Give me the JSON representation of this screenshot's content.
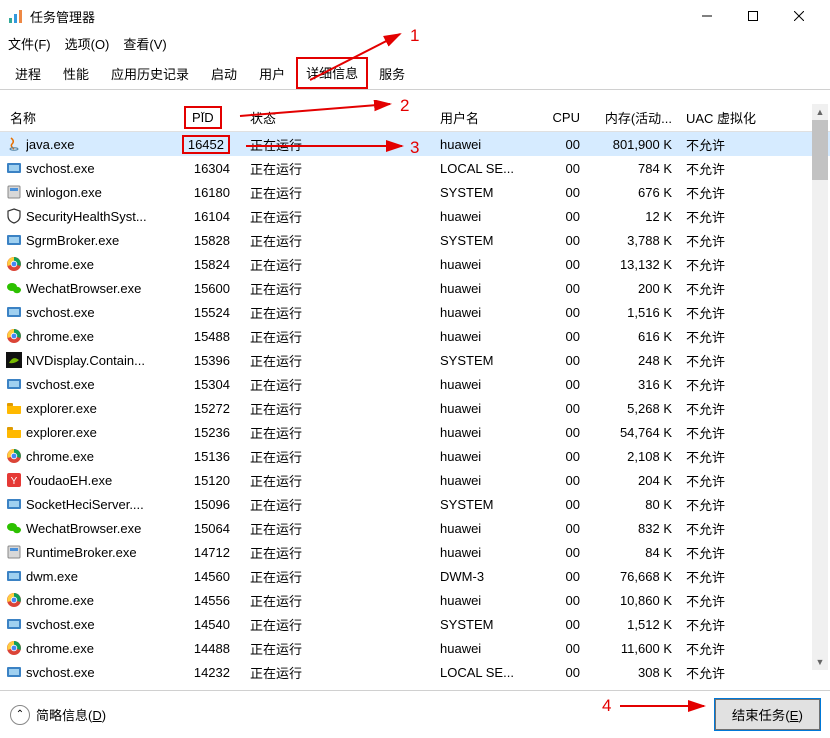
{
  "window": {
    "title": "任务管理器"
  },
  "menu": {
    "file": "文件(F)",
    "options": "选项(O)",
    "view": "查看(V)"
  },
  "tabs": {
    "processes": "进程",
    "performance": "性能",
    "app_history": "应用历史记录",
    "startup": "启动",
    "users": "用户",
    "details": "详细信息",
    "services": "服务"
  },
  "columns": {
    "name": "名称",
    "pid": "PID",
    "status": "状态",
    "user": "用户名",
    "cpu": "CPU",
    "mem": "内存(活动...",
    "uac": "UAC 虚拟化"
  },
  "rows": [
    {
      "icon": "java",
      "name": "java.exe",
      "pid": "16452",
      "status": "正在运行",
      "user": "huawei",
      "cpu": "00",
      "mem": "801,900 K",
      "uac": "不允许",
      "selected": true,
      "pid_hl": true
    },
    {
      "icon": "svc",
      "name": "svchost.exe",
      "pid": "16304",
      "status": "正在运行",
      "user": "LOCAL SE...",
      "cpu": "00",
      "mem": "784 K",
      "uac": "不允许"
    },
    {
      "icon": "exe",
      "name": "winlogon.exe",
      "pid": "16180",
      "status": "正在运行",
      "user": "SYSTEM",
      "cpu": "00",
      "mem": "676 K",
      "uac": "不允许"
    },
    {
      "icon": "shield",
      "name": "SecurityHealthSyst...",
      "pid": "16104",
      "status": "正在运行",
      "user": "huawei",
      "cpu": "00",
      "mem": "12 K",
      "uac": "不允许"
    },
    {
      "icon": "svc",
      "name": "SgrmBroker.exe",
      "pid": "15828",
      "status": "正在运行",
      "user": "SYSTEM",
      "cpu": "00",
      "mem": "3,788 K",
      "uac": "不允许"
    },
    {
      "icon": "chrome",
      "name": "chrome.exe",
      "pid": "15824",
      "status": "正在运行",
      "user": "huawei",
      "cpu": "00",
      "mem": "13,132 K",
      "uac": "不允许"
    },
    {
      "icon": "wechat",
      "name": "WechatBrowser.exe",
      "pid": "15600",
      "status": "正在运行",
      "user": "huawei",
      "cpu": "00",
      "mem": "200 K",
      "uac": "不允许"
    },
    {
      "icon": "svc",
      "name": "svchost.exe",
      "pid": "15524",
      "status": "正在运行",
      "user": "huawei",
      "cpu": "00",
      "mem": "1,516 K",
      "uac": "不允许"
    },
    {
      "icon": "chrome",
      "name": "chrome.exe",
      "pid": "15488",
      "status": "正在运行",
      "user": "huawei",
      "cpu": "00",
      "mem": "616 K",
      "uac": "不允许"
    },
    {
      "icon": "nvidia",
      "name": "NVDisplay.Contain...",
      "pid": "15396",
      "status": "正在运行",
      "user": "SYSTEM",
      "cpu": "00",
      "mem": "248 K",
      "uac": "不允许"
    },
    {
      "icon": "svc",
      "name": "svchost.exe",
      "pid": "15304",
      "status": "正在运行",
      "user": "huawei",
      "cpu": "00",
      "mem": "316 K",
      "uac": "不允许"
    },
    {
      "icon": "explorer",
      "name": "explorer.exe",
      "pid": "15272",
      "status": "正在运行",
      "user": "huawei",
      "cpu": "00",
      "mem": "5,268 K",
      "uac": "不允许"
    },
    {
      "icon": "explorer",
      "name": "explorer.exe",
      "pid": "15236",
      "status": "正在运行",
      "user": "huawei",
      "cpu": "00",
      "mem": "54,764 K",
      "uac": "不允许"
    },
    {
      "icon": "chrome",
      "name": "chrome.exe",
      "pid": "15136",
      "status": "正在运行",
      "user": "huawei",
      "cpu": "00",
      "mem": "2,108 K",
      "uac": "不允许"
    },
    {
      "icon": "youdao",
      "name": "YoudaoEH.exe",
      "pid": "15120",
      "status": "正在运行",
      "user": "huawei",
      "cpu": "00",
      "mem": "204 K",
      "uac": "不允许"
    },
    {
      "icon": "svc",
      "name": "SocketHeciServer....",
      "pid": "15096",
      "status": "正在运行",
      "user": "SYSTEM",
      "cpu": "00",
      "mem": "80 K",
      "uac": "不允许"
    },
    {
      "icon": "wechat",
      "name": "WechatBrowser.exe",
      "pid": "15064",
      "status": "正在运行",
      "user": "huawei",
      "cpu": "00",
      "mem": "832 K",
      "uac": "不允许"
    },
    {
      "icon": "exe",
      "name": "RuntimeBroker.exe",
      "pid": "14712",
      "status": "正在运行",
      "user": "huawei",
      "cpu": "00",
      "mem": "84 K",
      "uac": "不允许"
    },
    {
      "icon": "svc",
      "name": "dwm.exe",
      "pid": "14560",
      "status": "正在运行",
      "user": "DWM-3",
      "cpu": "00",
      "mem": "76,668 K",
      "uac": "不允许"
    },
    {
      "icon": "chrome",
      "name": "chrome.exe",
      "pid": "14556",
      "status": "正在运行",
      "user": "huawei",
      "cpu": "00",
      "mem": "10,860 K",
      "uac": "不允许"
    },
    {
      "icon": "svc",
      "name": "svchost.exe",
      "pid": "14540",
      "status": "正在运行",
      "user": "SYSTEM",
      "cpu": "00",
      "mem": "1,512 K",
      "uac": "不允许"
    },
    {
      "icon": "chrome",
      "name": "chrome.exe",
      "pid": "14488",
      "status": "正在运行",
      "user": "huawei",
      "cpu": "00",
      "mem": "11,600 K",
      "uac": "不允许"
    },
    {
      "icon": "svc",
      "name": "svchost.exe",
      "pid": "14232",
      "status": "正在运行",
      "user": "LOCAL SE...",
      "cpu": "00",
      "mem": "308 K",
      "uac": "不允许"
    }
  ],
  "footer": {
    "fewer": "简略信息(",
    "fewer_u": "D",
    "fewer_end": ")",
    "end_task": "结束任务(",
    "end_task_u": "E",
    "end_task_end": ")"
  },
  "annotations": {
    "a1": "1",
    "a2": "2",
    "a3": "3",
    "a4": "4"
  }
}
